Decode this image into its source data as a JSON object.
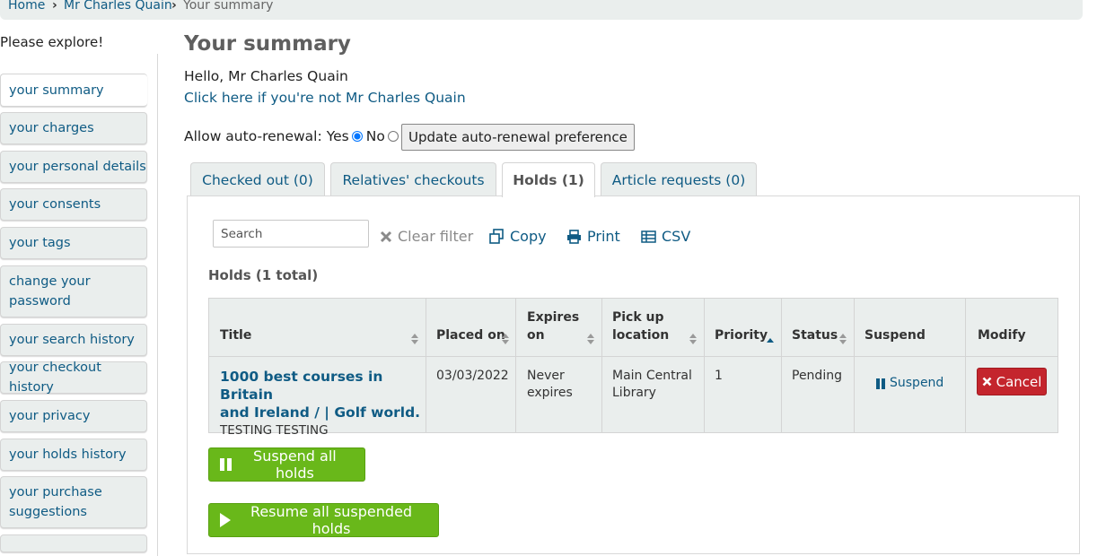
{
  "breadcrumb": {
    "home": "Home",
    "patron": "Mr Charles Quain",
    "current": "Your summary",
    "separator": "›"
  },
  "sidebar": {
    "heading": "Please explore!",
    "items": [
      {
        "label": "your summary"
      },
      {
        "label": "your charges"
      },
      {
        "label": "your personal details"
      },
      {
        "label": "your consents"
      },
      {
        "label": "your tags"
      },
      {
        "label": "change your password"
      },
      {
        "label": "your search history"
      },
      {
        "label": "your checkout history"
      },
      {
        "label": "your privacy"
      },
      {
        "label": "your holds history"
      },
      {
        "label": "your purchase suggestions"
      }
    ]
  },
  "main": {
    "title": "Your summary",
    "greeting": "Hello, Mr Charles Quain",
    "not_me_link": "Click here if you're not Mr Charles Quain",
    "auto_renewal": {
      "label": "Allow auto-renewal:",
      "yes": "Yes",
      "no": "No",
      "selected": "Yes",
      "button": "Update auto-renewal preference"
    },
    "tabs": [
      {
        "label": "Checked out (0)"
      },
      {
        "label": "Relatives' checkouts"
      },
      {
        "label": "Holds (1)"
      },
      {
        "label": "Article requests (0)"
      }
    ],
    "toolbar": {
      "search_placeholder": "Search",
      "clear": "Clear filter",
      "copy": "Copy",
      "print": "Print",
      "csv": "CSV"
    },
    "holds_total": "Holds (1 total)",
    "table": {
      "headers": {
        "title": "Title",
        "placed_on": "Placed on",
        "expires_l1": "Expires",
        "expires_l2": "on",
        "pickup_l1": "Pick up",
        "pickup_l2": "location",
        "priority": "Priority",
        "status": "Status",
        "suspend": "Suspend",
        "modify": "Modify"
      },
      "rows": [
        {
          "title_l1": "1000 best courses in Britain",
          "title_l2": "and Ireland / | Golf world.",
          "author": "TESTING TESTING",
          "placed_on": "03/03/2022",
          "expires_l1": "Never",
          "expires_l2": "expires",
          "pickup_l1": "Main Central",
          "pickup_l2": "Library",
          "priority": "1",
          "status": "Pending",
          "suspend": "Suspend",
          "cancel": "Cancel"
        }
      ]
    },
    "suspend_all": "Suspend all holds",
    "resume_all": "Resume all suspended holds"
  },
  "colors": {
    "link": "#0f5b84",
    "green": "#69b81a",
    "danger": "#c4252d",
    "tab_bg": "#eaeeed"
  },
  "icons": [
    "close-icon",
    "copy-icon",
    "print-icon",
    "csv-table-icon",
    "pause-icon",
    "play-icon",
    "sort-icon"
  ]
}
